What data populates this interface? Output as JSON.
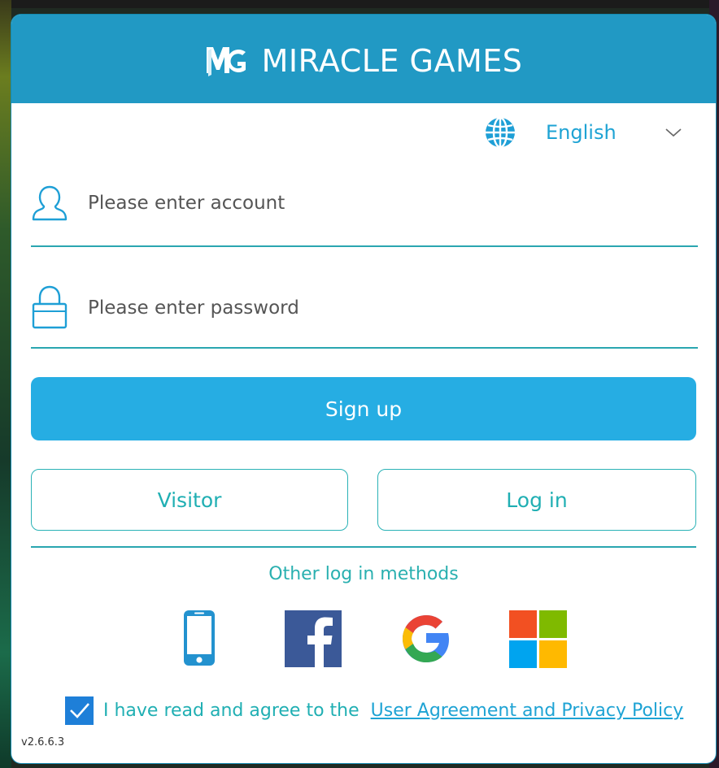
{
  "header": {
    "brand": "MIRACLE GAMES",
    "logo": "MG"
  },
  "language": {
    "icon": "globe-icon",
    "selected": "English",
    "dropdown_icon": "chevron-down-icon"
  },
  "account": {
    "placeholder": "Please enter account",
    "value": "",
    "icon": "user-icon"
  },
  "password": {
    "placeholder": "Please enter password",
    "value": "",
    "icon": "lock-icon"
  },
  "buttons": {
    "signup": "Sign up",
    "visitor": "Visitor",
    "login": "Log in"
  },
  "other_methods": {
    "label": "Other log in methods",
    "methods": [
      "phone-icon",
      "facebook-icon",
      "google-icon",
      "microsoft-icon"
    ]
  },
  "agreement": {
    "checked": true,
    "text": "I have read and agree to the",
    "link": "User Agreement and Privacy Policy"
  },
  "version": "v2.6.6.3",
  "colors": {
    "header": "#2199c4",
    "accent_blue": "#26ade3",
    "accent_teal": "#2ab2b6",
    "checkbox": "#1e7fd8"
  }
}
